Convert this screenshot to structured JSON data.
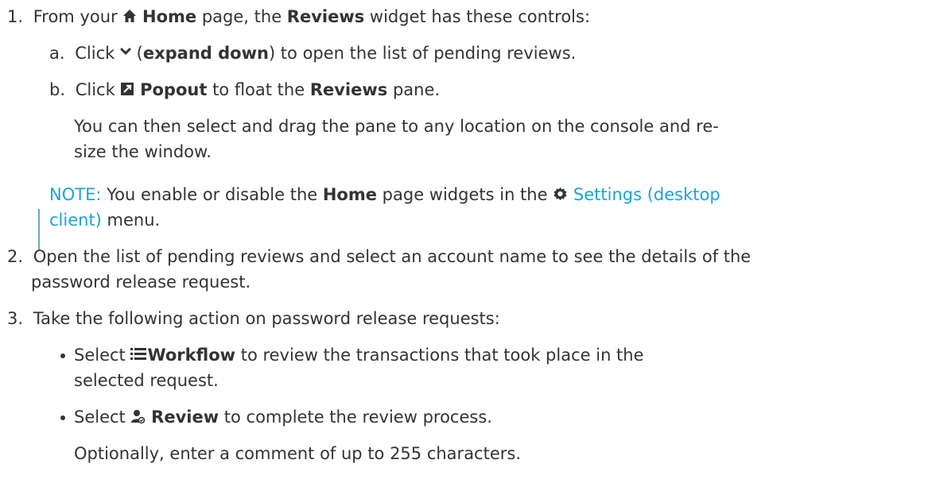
{
  "steps": [
    {
      "number": "1.",
      "text_before": "From your ",
      "home_label": "Home",
      "text_mid": " page, the ",
      "reviews_label": "Reviews",
      "text_after": " widget has these controls:",
      "substeps": [
        {
          "letter": "a.",
          "text_before": "Click ",
          "paren_open": " (",
          "bold": "expand down",
          "text_after": ") to open the list of pending reviews."
        },
        {
          "letter": "b.",
          "text_before": "Click ",
          "bold": "Popout",
          "text_mid": " to float the ",
          "bold2": "Reviews",
          "text_after": " pane.",
          "para_line1": "You can then select and drag the pane to any location on the console and re-",
          "para_line2": "size the window."
        }
      ]
    },
    {
      "number": "2.",
      "line1": "Open the list of pending reviews and select an account name to see the details of the",
      "line2": "password release request."
    },
    {
      "number": "3.",
      "line1": "Take the following action on password release requests:",
      "bullets": [
        {
          "text_before": "Select ",
          "bold": "Workflow",
          "text_after": " to review the transactions that took place in the",
          "line2": "selected request."
        },
        {
          "text_before": "Select ",
          "bold": "Review",
          "text_after": " to complete the review process.",
          "para": "Optionally, enter a comment of up to 255 characters."
        }
      ]
    }
  ],
  "note": {
    "label": "NOTE:",
    "text_before": " You enable or disable the ",
    "bold": "Home",
    "text_mid": " page widgets in the ",
    "link_line1": "Settings (desktop",
    "link_line2": "client)",
    "text_after": " menu."
  },
  "colors": {
    "text": "#333333",
    "link": "#1ca3d6",
    "note_bar": "#6aa8c8"
  },
  "icons": [
    "home-icon",
    "chevron-down-icon",
    "popout-icon",
    "gear-icon",
    "list-icon",
    "reviewer-icon"
  ]
}
